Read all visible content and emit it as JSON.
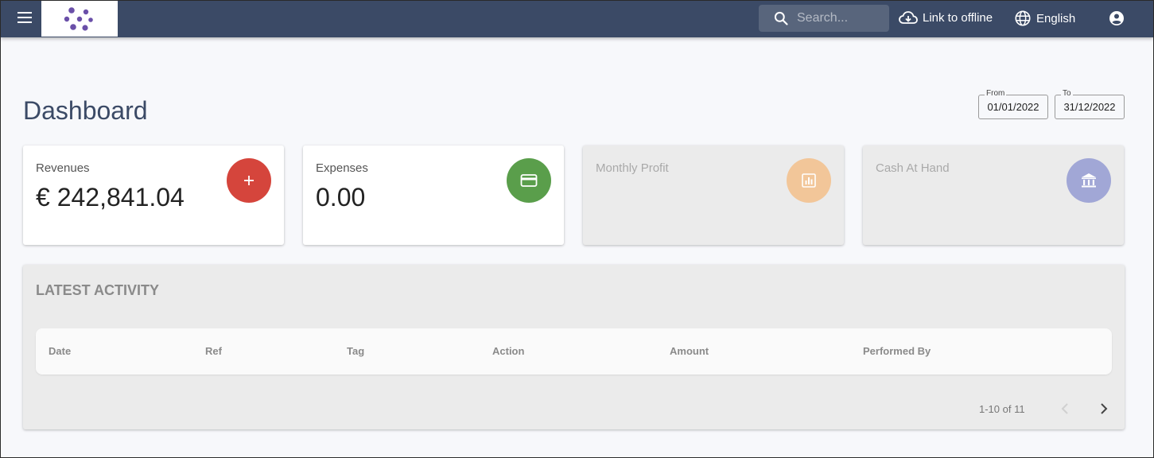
{
  "topbar": {
    "search_placeholder": "Search...",
    "offline_label": "Link to offline",
    "language_label": "English"
  },
  "page": {
    "title": "Dashboard"
  },
  "date_range": {
    "from_label": "From",
    "from_value": "01/01/2022",
    "to_label": "To",
    "to_value": "31/12/2022"
  },
  "cards": [
    {
      "label": "Revenues",
      "value": "€ 242,841.04",
      "icon": "plus-icon",
      "color": "#d5453c"
    },
    {
      "label": "Expenses",
      "value": "0.00",
      "icon": "credit-card-icon",
      "color": "#5a9e4b"
    },
    {
      "label": "Monthly Profit",
      "value": "",
      "icon": "chart-icon",
      "color": "#f2c699"
    },
    {
      "label": "Cash At Hand",
      "value": "",
      "icon": "bank-icon",
      "color": "#a1a7d6"
    }
  ],
  "activity": {
    "title": "LATEST ACTIVITY",
    "columns": [
      "Date",
      "Ref",
      "Tag",
      "Action",
      "Amount",
      "Performed By"
    ],
    "pagination": "1-10 of 11"
  },
  "colors": {
    "topbar": "#3b4a66",
    "accent": "#3b4a66",
    "logo": "#6a4fa8"
  }
}
